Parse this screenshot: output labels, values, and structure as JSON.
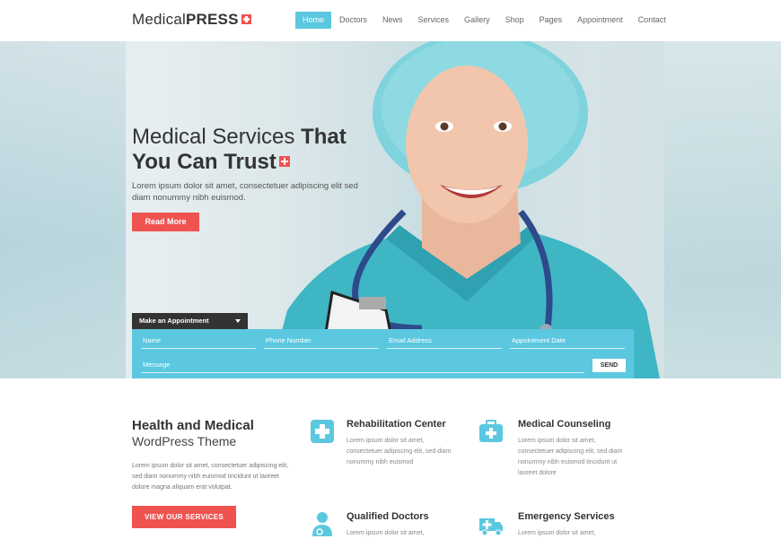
{
  "header": {
    "logo_light": "Medical",
    "logo_bold": "PRESS",
    "nav": [
      "Home",
      "Doctors",
      "News",
      "Services",
      "Gallery",
      "Shop",
      "Pages",
      "Appointment",
      "Contact"
    ],
    "active_nav": "Home"
  },
  "hero": {
    "title_light": "Medical Services",
    "title_bold_1": "That",
    "title_bold_2": "You Can Trust",
    "text": "Lorem ipsum dolor sit amet, consectetuer adipiscing elit sed diam nonummy nibh euismod.",
    "button": "Read More"
  },
  "appointment": {
    "tab_label": "Make an Appointment",
    "name_placeholder": "Name",
    "phone_placeholder": "Phone Number",
    "email_placeholder": "Email Address",
    "date_placeholder": "Appointment Date",
    "message_placeholder": "Message",
    "send_label": "SEND"
  },
  "about": {
    "title": "Health and Medical",
    "subtitle": "WordPress Theme",
    "text": "Lorem ipsum dolor sit amet, consectetuer adipiscing elit, sed diam nonummy nibh euismod tincidunt ut laoreet dolore magna aliquam erat volutpat.",
    "button": "VIEW OUR SERVICES"
  },
  "services": [
    {
      "title": "Rehabilitation Center",
      "text": "Lorem ipsum dolor sit amet, consectetuer adipiscing elit, sed diam nonummy nibh euismod",
      "icon": "medical-cross-icon"
    },
    {
      "title": "Medical Counseling",
      "text": "Lorem ipsum dolor sit amet, consectetuer adipiscing elit, sed diam nonummy nibh euismod tincidunt ut laoreet dolore",
      "icon": "medical-kit-icon"
    },
    {
      "title": "Qualified Doctors",
      "text": "Lorem ipsum dolor sit amet,",
      "icon": "doctor-icon"
    },
    {
      "title": "Emergency Services",
      "text": "Lorem ipsum dolor sit amet,",
      "icon": "ambulance-icon"
    }
  ],
  "colors": {
    "accent": "#5bc8e0",
    "brand_red": "#ef5350"
  }
}
